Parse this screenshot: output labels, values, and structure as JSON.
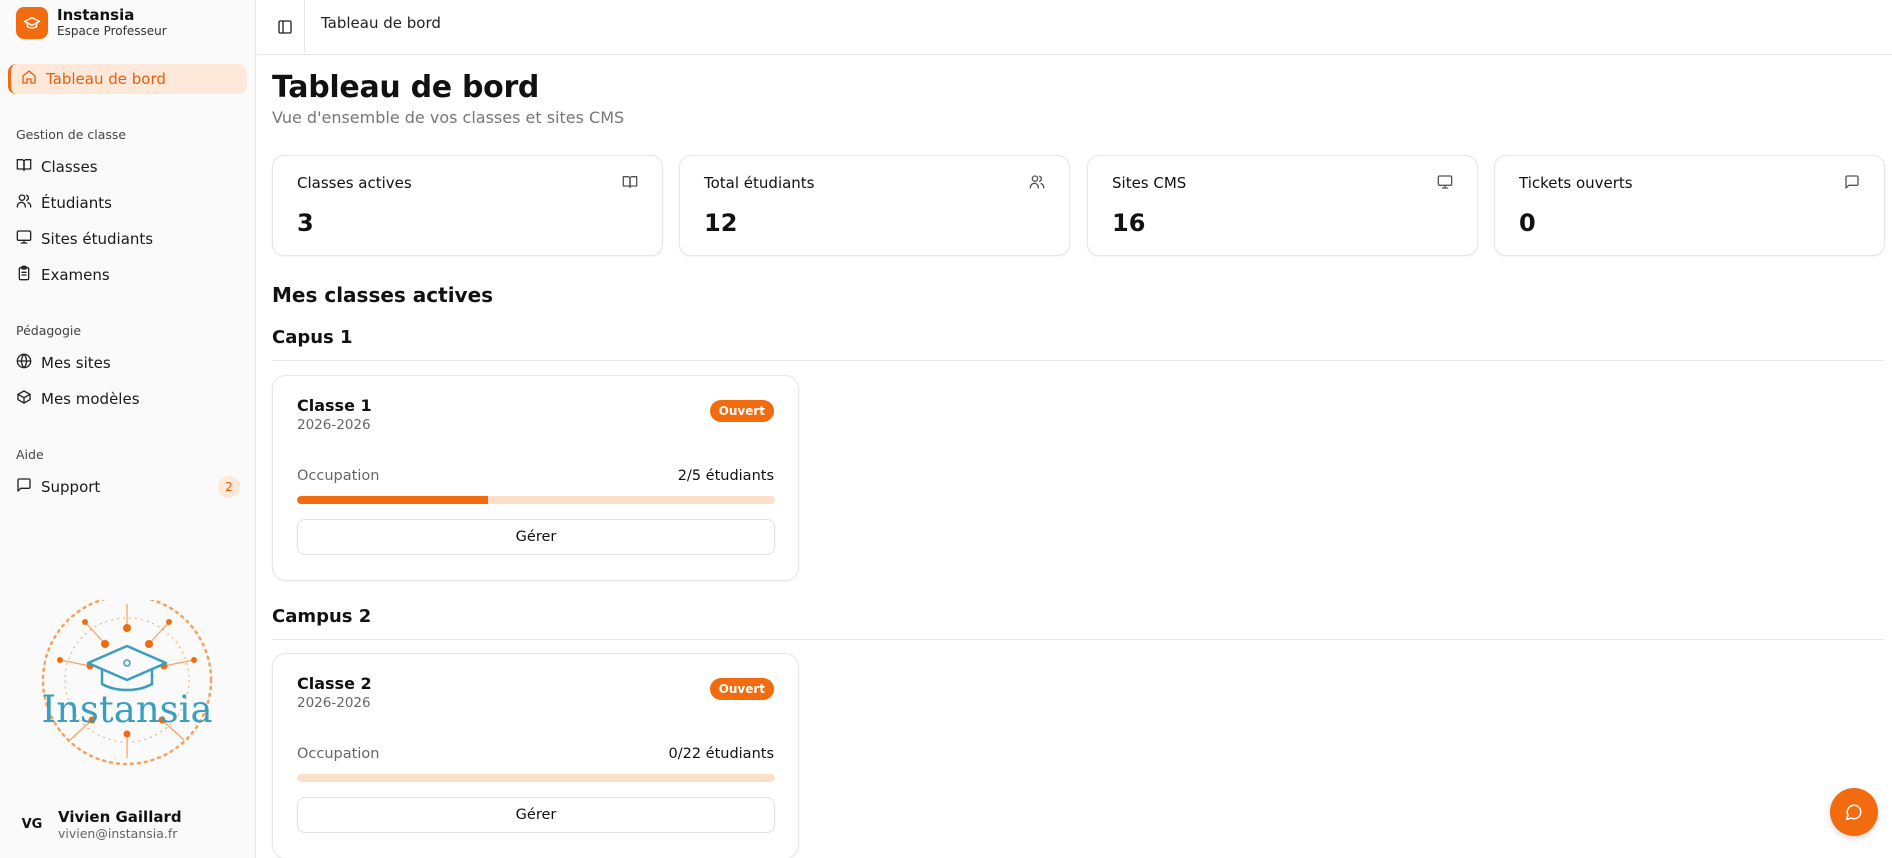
{
  "brand": {
    "name": "Instansia",
    "subtitle": "Espace Professeur"
  },
  "sidebar": {
    "active": {
      "label": "Tableau de bord",
      "icon": "home-icon"
    },
    "sections": [
      {
        "label": "Gestion de classe",
        "items": [
          {
            "label": "Classes",
            "icon": "book-icon"
          },
          {
            "label": "Étudiants",
            "icon": "users-icon"
          },
          {
            "label": "Sites étudiants",
            "icon": "monitor-icon"
          },
          {
            "label": "Examens",
            "icon": "clipboard-icon"
          }
        ]
      },
      {
        "label": "Pédagogie",
        "items": [
          {
            "label": "Mes sites",
            "icon": "globe-icon"
          },
          {
            "label": "Mes modèles",
            "icon": "box-icon"
          }
        ]
      },
      {
        "label": "Aide",
        "items": [
          {
            "label": "Support",
            "icon": "message-icon",
            "badge": "2"
          }
        ]
      }
    ],
    "illustration_text": "Instansia",
    "user": {
      "initials": "VG",
      "name": "Vivien Gaillard",
      "email": "vivien@instansia.fr"
    }
  },
  "topbar": {
    "breadcrumb": "Tableau de bord"
  },
  "main": {
    "title": "Tableau de bord",
    "subtitle": "Vue d'ensemble de vos classes et sites CMS",
    "stats": [
      {
        "label": "Classes actives",
        "value": "3",
        "icon": "book-icon"
      },
      {
        "label": "Total étudiants",
        "value": "12",
        "icon": "users-icon"
      },
      {
        "label": "Sites CMS",
        "value": "16",
        "icon": "monitor-icon"
      },
      {
        "label": "Tickets ouverts",
        "value": "0",
        "icon": "message-icon"
      }
    ],
    "section_title": "Mes classes actives",
    "campuses": [
      {
        "name": "Capus 1",
        "classes": [
          {
            "name": "Classe 1",
            "year": "2026-2026",
            "status": "Ouvert",
            "occupation_label": "Occupation",
            "occupation": "2/5 étudiants",
            "fill_fraction": 0.4,
            "button": "Gérer"
          }
        ]
      },
      {
        "name": "Campus 2",
        "classes": [
          {
            "name": "Classe 2",
            "year": "2026-2026",
            "status": "Ouvert",
            "occupation_label": "Occupation",
            "occupation": "0/22 étudiants",
            "fill_fraction": 0,
            "button": "Gérer"
          }
        ]
      }
    ]
  },
  "colors": {
    "accent": "#f26b0f",
    "accent_soft": "#fde8d9",
    "illustration_teal": "#3a9fbf"
  }
}
